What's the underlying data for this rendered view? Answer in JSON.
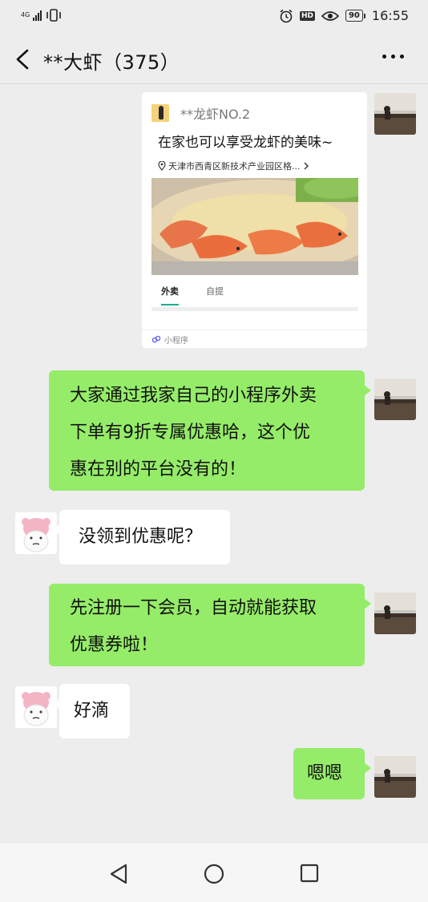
{
  "status_bar": {
    "network": "4G",
    "battery": "90",
    "time": "16:55",
    "hd_badge": "HD"
  },
  "header": {
    "title": "**大虾（375）"
  },
  "mini_program_card": {
    "source_name": "**龙虾NO.2",
    "title": "在家也可以享受龙虾的美味~",
    "address": "天津市西青区新技术产业园区格...",
    "tabs": [
      "外卖",
      "自提"
    ],
    "footer_label": "小程序"
  },
  "messages": [
    {
      "from": "self",
      "text_lines": [
        "大家通过我家自己的小程序外卖",
        "下单有9折专属优惠哈，这个优",
        "惠在别的平台没有的！"
      ]
    },
    {
      "from": "other",
      "text_lines": [
        "没领到优惠呢？"
      ]
    },
    {
      "from": "self",
      "text_lines": [
        "先注册一下会员，自动就能获取",
        "优惠券啦！"
      ]
    },
    {
      "from": "other",
      "text_lines": [
        "好滴"
      ]
    },
    {
      "from": "self",
      "text_lines": [
        "嗯嗯"
      ]
    }
  ],
  "colors": {
    "self_bubble": "#95ec69",
    "other_bubble": "#ffffff",
    "chat_background": "#ededed"
  },
  "icons": {
    "back": "back-arrow-icon",
    "more": "more-dots-icon",
    "location": "location-pin-icon",
    "mini_program": "mini-program-icon",
    "alarm": "alarm-icon",
    "eye": "eye-comfort-icon",
    "vibrate": "vibrate-icon",
    "nav_back": "triangle-back-icon",
    "nav_home": "circle-home-icon",
    "nav_recent": "square-recents-icon"
  }
}
